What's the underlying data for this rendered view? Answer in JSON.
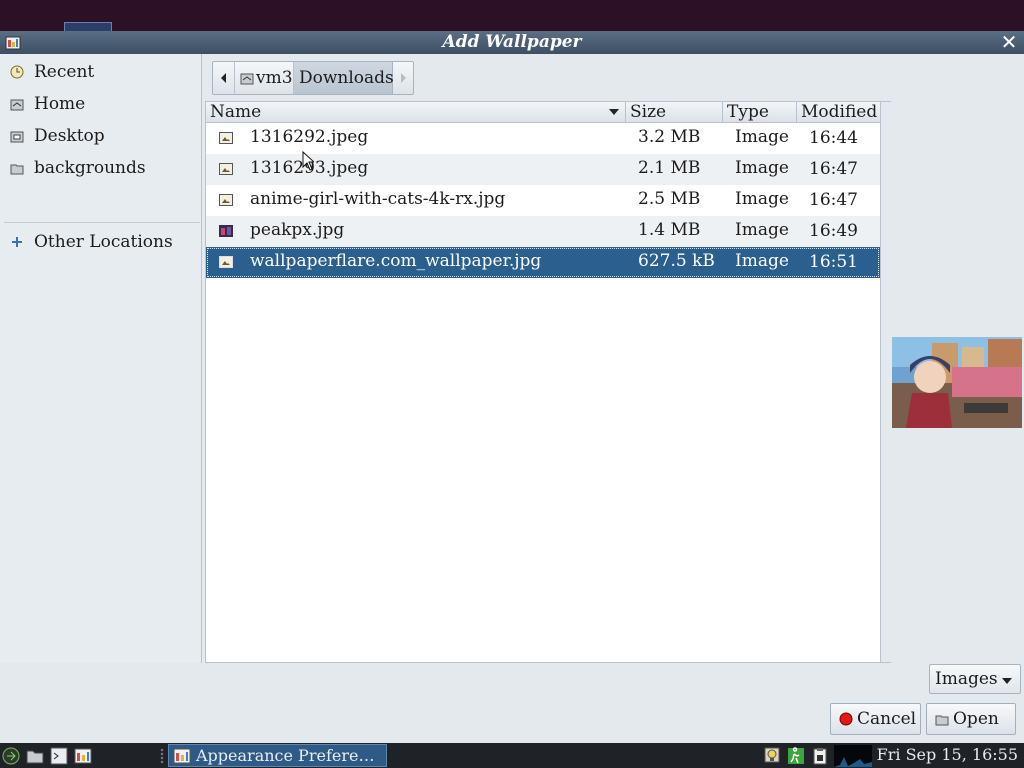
{
  "dialog": {
    "title": "Add Wallpaper",
    "close_label": "✕"
  },
  "sidebar": {
    "items": [
      {
        "label": "Recent",
        "icon": "recent-icon"
      },
      {
        "label": "Home",
        "icon": "home-icon"
      },
      {
        "label": "Desktop",
        "icon": "desktop-folder-icon"
      },
      {
        "label": "backgrounds",
        "icon": "folder-icon"
      },
      {
        "label": "Other Locations",
        "icon": "plus-icon"
      }
    ]
  },
  "pathbar": {
    "home": "vm3",
    "current": "Downloads"
  },
  "filelist": {
    "columns": {
      "name": "Name",
      "size": "Size",
      "type": "Type",
      "modified": "Modified"
    },
    "files": [
      {
        "name": "1316292.jpeg",
        "size": "3.2 MB",
        "type": "Image",
        "modified": "16:44",
        "icon": "image-file-icon"
      },
      {
        "name": "1316293.jpeg",
        "size": "2.1 MB",
        "type": "Image",
        "modified": "16:47",
        "icon": "image-file-icon"
      },
      {
        "name": "anime-girl-with-cats-4k-rx.jpg",
        "size": "2.5 MB",
        "type": "Image",
        "modified": "16:47",
        "icon": "image-file-icon"
      },
      {
        "name": "peakpx.jpg",
        "size": "1.4 MB",
        "type": "Image",
        "modified": "16:49",
        "icon": "image-thumbnail-icon"
      },
      {
        "name": "wallpaperflare.com_wallpaper.jpg",
        "size": "627.5 kB",
        "type": "Image",
        "modified": "16:51",
        "icon": "image-file-icon",
        "selected": true
      }
    ]
  },
  "filter": {
    "selected": "Images"
  },
  "buttons": {
    "cancel": "Cancel",
    "open": "Open"
  },
  "taskbar": {
    "task_label": "Appearance Prefere…",
    "clock": "Fri Sep 15, 16:55"
  },
  "colors": {
    "selection": "#2a5f8e",
    "titlebar": "#4b5f74",
    "taskbar": "#1f2328"
  }
}
